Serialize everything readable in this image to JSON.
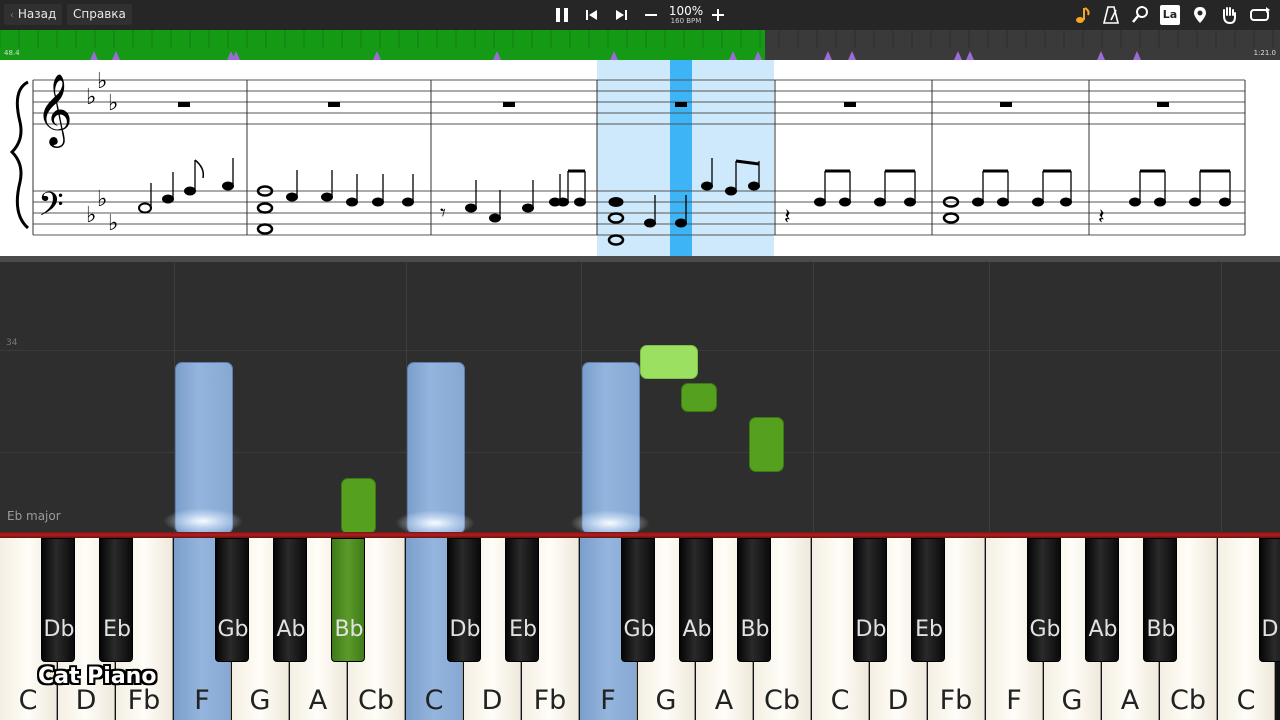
{
  "toolbar": {
    "back_label": "Назад",
    "help_label": "Справка",
    "zoom": "100%",
    "bpm": "160 BPM",
    "icons": [
      "pause-icon",
      "prev-icon",
      "next-icon",
      "minus-icon",
      "plus-icon",
      "note-icon",
      "metronome-icon",
      "search-icon",
      "note-names-icon",
      "marker-icon",
      "hand-icon",
      "loop-icon"
    ],
    "note_names_label": "La"
  },
  "timeline": {
    "start_time": "48.4",
    "end_time": "1:21.0",
    "progress": 0.598,
    "played_color": "#149a14",
    "marker_color": "#9b6bd6"
  },
  "score": {
    "key_signature": "Eb major",
    "highlight_color": "#cde9fb",
    "cursor_color": "#3cb4f5"
  },
  "roll": {
    "measure_number": "34",
    "key_label": "Eb major",
    "colors": {
      "left_hand": "#8aaad4",
      "right_hand": "#56a01f",
      "upcoming": "#9ce062"
    }
  },
  "keyboard": {
    "white_keys": [
      "C",
      "D",
      "Fb",
      "F",
      "G",
      "A",
      "Cb",
      "C",
      "D",
      "Fb",
      "F",
      "G",
      "A",
      "Cb",
      "C",
      "D",
      "Fb",
      "F",
      "G",
      "A",
      "Cb",
      "C"
    ],
    "black_keys": [
      "Db",
      "Eb",
      "Gb",
      "Ab",
      "Bb",
      "Db",
      "Eb",
      "Gb",
      "Ab",
      "Bb",
      "Db",
      "Eb",
      "Gb",
      "Ab",
      "Bb",
      "Db"
    ],
    "pressed_white": [
      3,
      7,
      10
    ],
    "pressed_black": [
      4
    ]
  },
  "brand": "Cat Piano"
}
